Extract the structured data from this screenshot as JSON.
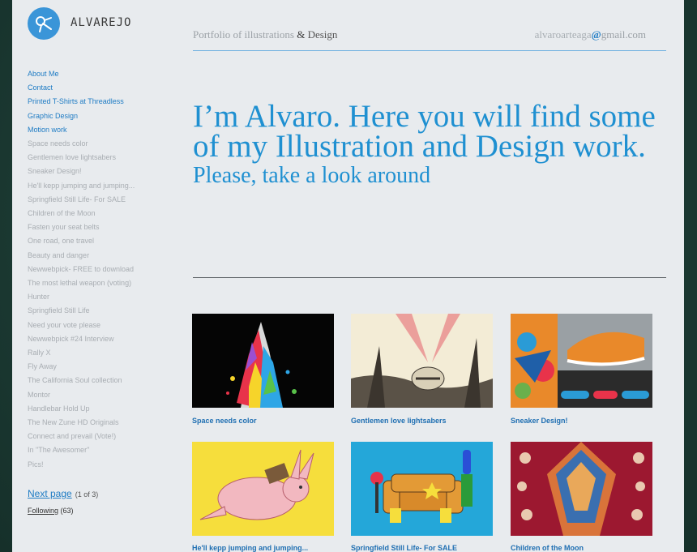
{
  "site": {
    "logo_text": "ALVAREJO",
    "tagline": "Portfolio of illustrations",
    "tagline_amp": "&",
    "tagline_end": "Design",
    "email_user": "alvaroarteaga",
    "email_at": "@",
    "email_domain": "gmail.com"
  },
  "hero": {
    "headline": "I’m Alvaro. Here you will find some of my Illustration and Design work.",
    "subline": "Please, take a look around"
  },
  "sidebar": {
    "nav": [
      "About Me",
      "Contact",
      "Printed T-Shirts at Threadless",
      "Graphic Design",
      "Motion work"
    ],
    "posts": [
      "Space needs color",
      "Gentlemen love lightsabers",
      "Sneaker Design!",
      "He'll kepp jumping and jumping...",
      "Springfield Still Life- For SALE",
      "Children of the Moon",
      "Fasten your seat belts",
      "One road, one travel",
      "Beauty and danger",
      "Newwebpick- FREE to download",
      "The most lethal weapon (voting)",
      "Hunter",
      "Springfield Still Life",
      "Need your vote please",
      "Newwebpick #24 Interview",
      "Rally X",
      "Fly Away",
      "The California Soul collection",
      "Montor",
      "Handlebar Hold Up",
      "The New Zune HD Originals",
      "Connect and prevail (Vote!)",
      "In \"The Awesomer\"",
      "Pics!"
    ],
    "next_page": "Next page",
    "page_count": "(1 of 3)",
    "following_label": "Following",
    "following_count": "(63)"
  },
  "gallery": [
    {
      "caption": "Space needs color",
      "art": "space"
    },
    {
      "caption": "Gentlemen love lightsabers",
      "art": "lightsabers"
    },
    {
      "caption": "Sneaker Design!",
      "art": "sneaker"
    },
    {
      "caption": "He'll kepp jumping and jumping...",
      "art": "rabbit"
    },
    {
      "caption": "Springfield Still Life- For SALE",
      "art": "couch"
    },
    {
      "caption": "Children of the Moon",
      "art": "moon"
    }
  ],
  "colors": {
    "accent": "#1f90d1",
    "link": "#1f7cc4",
    "muted": "#a8adb2",
    "page": "#e8ebee"
  }
}
